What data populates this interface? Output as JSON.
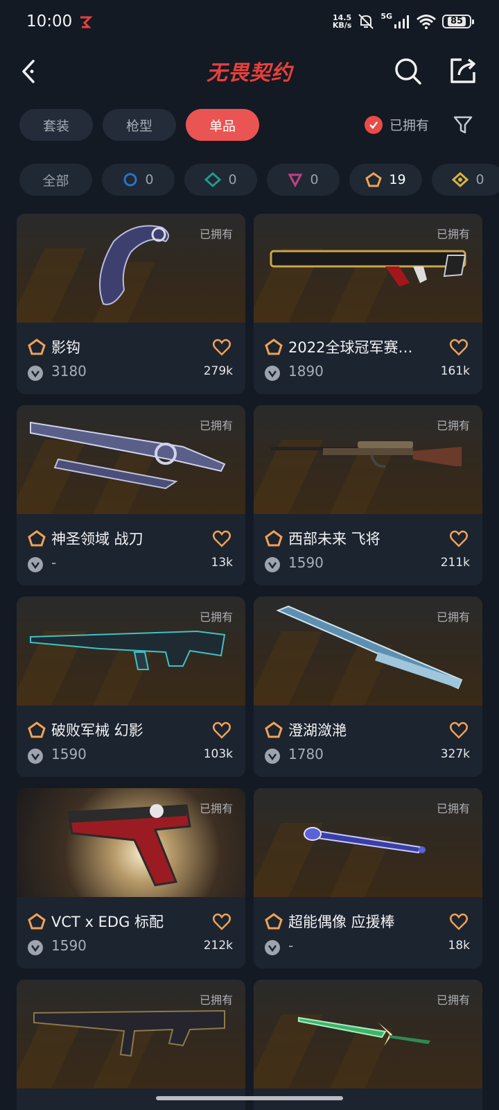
{
  "status": {
    "time": "10:00",
    "net_speed_top": "14.5",
    "net_speed_bottom": "KB/s",
    "signal_label": "5G",
    "battery": "85"
  },
  "header": {
    "title": "无畏契约"
  },
  "tabs": [
    {
      "label": "套装"
    },
    {
      "label": "枪型"
    },
    {
      "label": "单品"
    }
  ],
  "owned_filter": {
    "label": "已拥有",
    "checked": true
  },
  "rarity_chips": [
    {
      "label": "全部"
    },
    {
      "count": "0",
      "icon": "select-tier-icon",
      "color": "#2a73c6"
    },
    {
      "count": "0",
      "icon": "deluxe-tier-icon",
      "color": "#1f9a8c"
    },
    {
      "count": "0",
      "icon": "premium-tier-icon",
      "color": "#c13f88"
    },
    {
      "count": "19",
      "icon": "exclusive-tier-icon",
      "color": "#f0a256"
    },
    {
      "count": "0",
      "icon": "ultra-tier-icon",
      "color": "#d9b441"
    }
  ],
  "owned_badge": "已拥有",
  "items": [
    {
      "name": "影钩",
      "price": "3180",
      "likes": "279k"
    },
    {
      "name": "2022全球冠军赛…",
      "price": "1890",
      "likes": "161k"
    },
    {
      "name": "神圣领域 战刀",
      "price": "-",
      "likes": "13k"
    },
    {
      "name": "西部未来 飞将",
      "price": "1590",
      "likes": "211k"
    },
    {
      "name": "破败军械 幻影",
      "price": "1590",
      "likes": "103k"
    },
    {
      "name": "澄湖潋滟",
      "price": "1780",
      "likes": "327k"
    },
    {
      "name": "VCT x EDG 标配",
      "price": "1590",
      "likes": "212k"
    },
    {
      "name": "超能偶像 应援棒",
      "price": "-",
      "likes": "18k"
    },
    {
      "name": "",
      "price": "",
      "likes": ""
    },
    {
      "name": "",
      "price": "",
      "likes": ""
    }
  ],
  "colors": {
    "accent": "#ea5452",
    "tier_exclusive": "#f0a256",
    "background": "#131a24",
    "card": "#1c2430"
  }
}
